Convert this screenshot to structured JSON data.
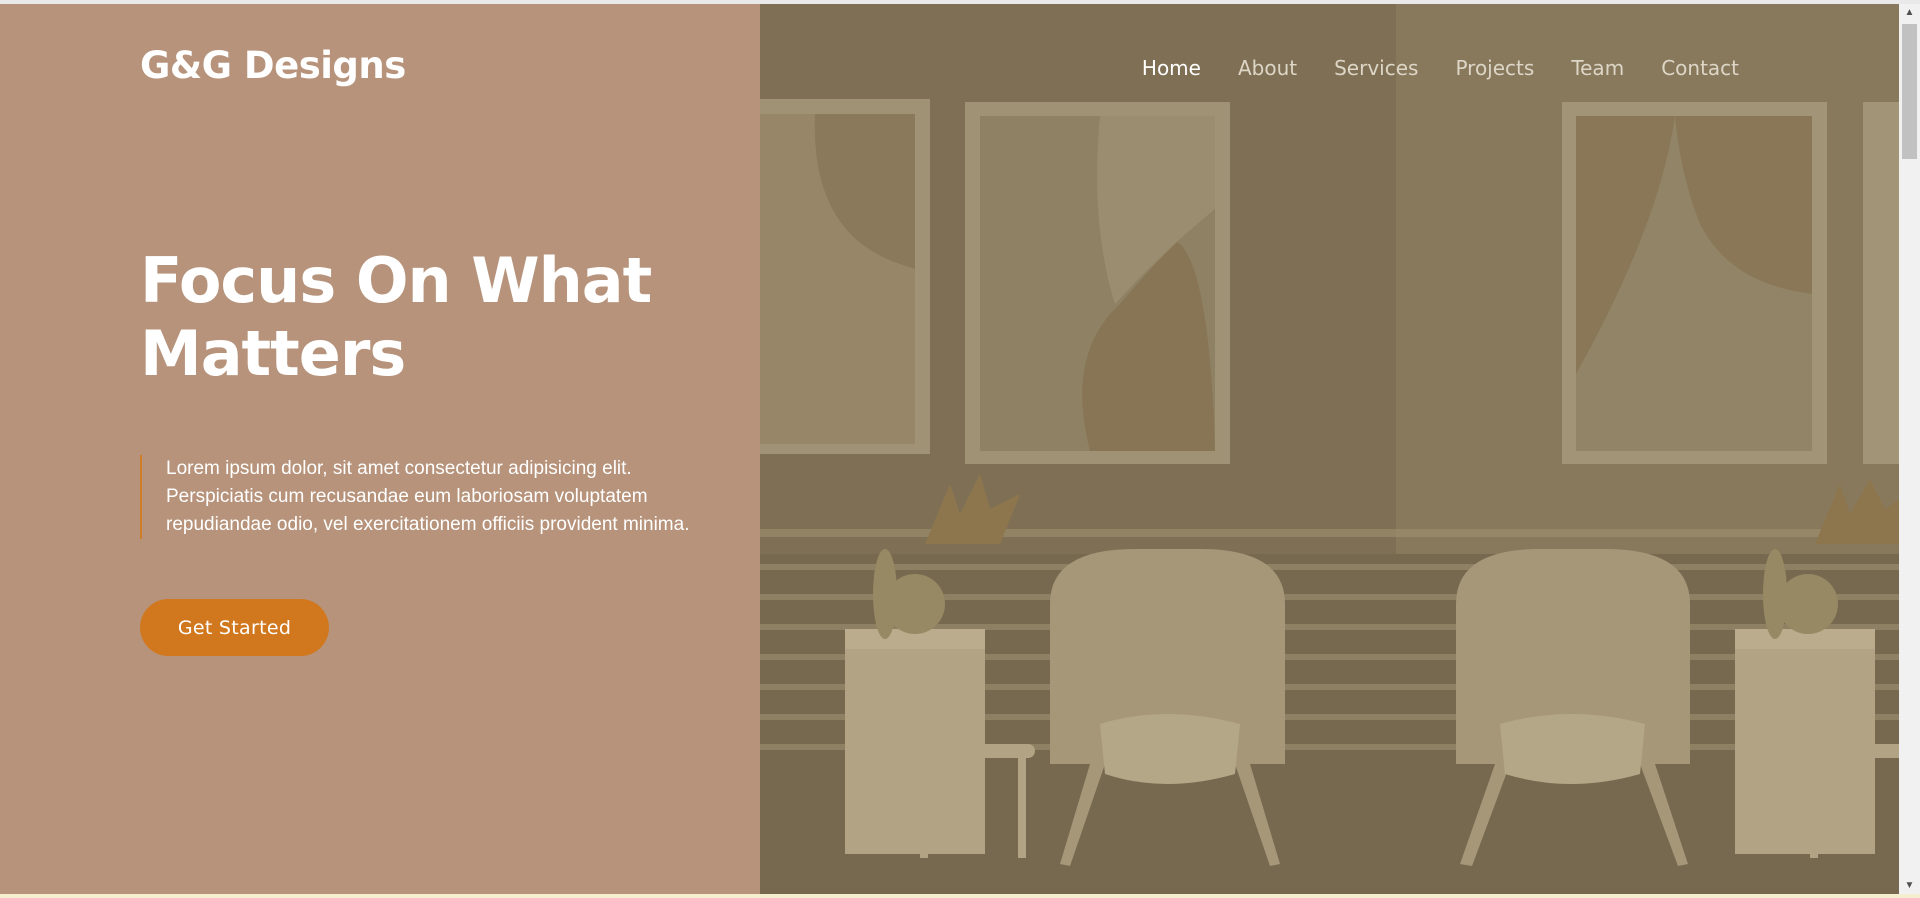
{
  "brand": {
    "name": "G&G Designs"
  },
  "nav": {
    "items": [
      {
        "label": "Home",
        "active": true
      },
      {
        "label": "About",
        "active": false
      },
      {
        "label": "Services",
        "active": false
      },
      {
        "label": "Projects",
        "active": false
      },
      {
        "label": "Team",
        "active": false
      },
      {
        "label": "Contact",
        "active": false
      }
    ]
  },
  "hero": {
    "title": "Focus On What Matters",
    "body": "Lorem ipsum dolor, sit amet consectetur adipisicing elit. Perspiciatis cum recusandae eum laboriosam voluptatem repudiandae odio, vel exercitationem officiis provident minima.",
    "cta_label": "Get Started",
    "image_alt": "Interior with armchairs, side tables, vases and framed abstract art"
  },
  "scrollbar": {
    "up_icon": "arrow-up-icon",
    "down_icon": "arrow-down-icon"
  },
  "colors": {
    "panel": "#b6937a",
    "accent": "#d1781e",
    "image_overlay": "#6b5f47"
  }
}
